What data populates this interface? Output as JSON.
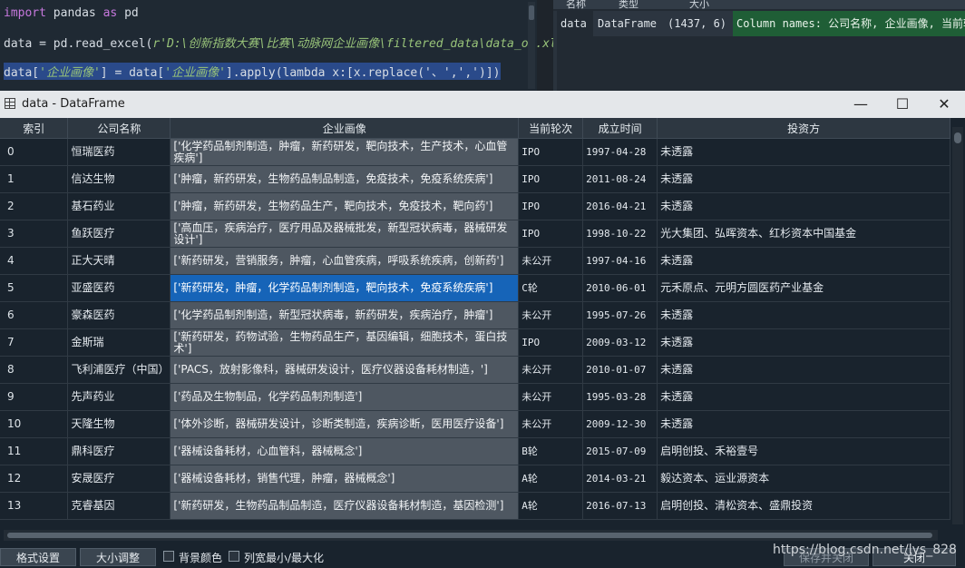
{
  "editor": {
    "line1": {
      "kw1": "import",
      "mid": " pandas ",
      "kw2": "as",
      "end": " pd"
    },
    "line2": {
      "pre": "data = pd.read_excel(",
      "str": "r'D:\\创新指数大赛\\比赛\\动脉网企业画像\\filtered_data\\data_ok.xls"
    },
    "line3": {
      "pre": "data[",
      "s1": "'企业画像'",
      "mid": "] = data[",
      "s2": "'企业画像'",
      "post": "].apply(lambda x:[x.replace('、',',')])"
    }
  },
  "variable_explorer": {
    "headers": [
      "名称",
      "类型",
      "大小"
    ],
    "row": {
      "name": "data",
      "type": "DataFrame",
      "size": "(1437, 6)",
      "value": "Column names: 公司名称, 企业画像, 当前轮"
    }
  },
  "dialog": {
    "title": "data - DataFrame",
    "minimize": "—",
    "maximize": "☐",
    "close": "✕"
  },
  "table": {
    "columns": [
      "索引",
      "公司名称",
      "企业画像",
      "当前轮次",
      "成立时间",
      "投资方"
    ],
    "rows": [
      [
        "0",
        "恒瑞医药",
        "['化学药品制剂制造，肿瘤，新药研发，靶向技术，生产技术，心血管疾病']",
        "IPO",
        "1997-04-28",
        "未透露"
      ],
      [
        "1",
        "信达生物",
        "['肿瘤，新药研发，生物药品制品制造，免疫技术，免疫系统疾病']",
        "IPO",
        "2011-08-24",
        "未透露"
      ],
      [
        "2",
        "基石药业",
        "['肿瘤，新药研发，生物药品生产，靶向技术，免疫技术，靶向药']",
        "IPO",
        "2016-04-21",
        "未透露"
      ],
      [
        "3",
        "鱼跃医疗",
        "['高血压，疾病治疗，医疗用品及器械批发，新型冠状病毒，器械研发设计']",
        "IPO",
        "1998-10-22",
        "光大集团、弘晖资本、红杉资本中国基金"
      ],
      [
        "4",
        "正大天晴",
        "['新药研发，营销服务，肿瘤，心血管疾病，呼吸系统疾病，创新药']",
        "未公开",
        "1997-04-16",
        "未透露"
      ],
      [
        "5",
        "亚盛医药",
        "['新药研发，肿瘤，化学药品制剂制造，靶向技术，免疫系统疾病']",
        "C轮",
        "2010-06-01",
        "元禾原点、元明方圆医药产业基金"
      ],
      [
        "6",
        "豪森医药",
        "['化学药品制剂制造，新型冠状病毒，新药研发，疾病治疗，肿瘤']",
        "未公开",
        "1995-07-26",
        "未透露"
      ],
      [
        "7",
        "金斯瑞",
        "['新药研发，药物试验，生物药品生产，基因编辑，细胞技术，蛋白技术']",
        "IPO",
        "2009-03-12",
        "未透露"
      ],
      [
        "8",
        "飞利浦医疗（中国）",
        "['PACS，放射影像科，器械研发设计，医疗仪器设备耗材制造，']",
        "未公开",
        "2010-01-07",
        "未透露"
      ],
      [
        "9",
        "先声药业",
        "['药品及生物制品，化学药品制剂制造']",
        "未公开",
        "1995-03-28",
        "未透露"
      ],
      [
        "10",
        "天隆生物",
        "['体外诊断，器械研发设计，诊断类制造，疾病诊断，医用医疗设备']",
        "未公开",
        "2009-12-30",
        "未透露"
      ],
      [
        "11",
        "鼎科医疗",
        "['器械设备耗材，心血管科，器械概念']",
        "B轮",
        "2015-07-09",
        "启明创投、禾裕壹号"
      ],
      [
        "12",
        "安晟医疗",
        "['器械设备耗材，销售代理，肿瘤，器械概念']",
        "A轮",
        "2014-03-21",
        "毅达资本、运业源资本"
      ],
      [
        "13",
        "克睿基因",
        "['新药研发，生物药品制品制造，医疗仪器设备耗材制造，基因检测']",
        "A轮",
        "2016-07-13",
        "启明创投、清松资本、盛鼎投资"
      ]
    ],
    "selected_row": 5
  },
  "bottom": {
    "format_button": "格式设置",
    "resize_button": "大小调整",
    "bg_color_label": "背景颜色",
    "col_width_label": "列宽最小/最大化",
    "save_close_button": "保存并关闭",
    "close_button": "关闭"
  },
  "watermark": "https://blog.csdn.net/lys_828",
  "colors": {
    "selection": "#1664b8",
    "portrait_bg": "#4e5761",
    "value_bg": "#1f5e36"
  }
}
